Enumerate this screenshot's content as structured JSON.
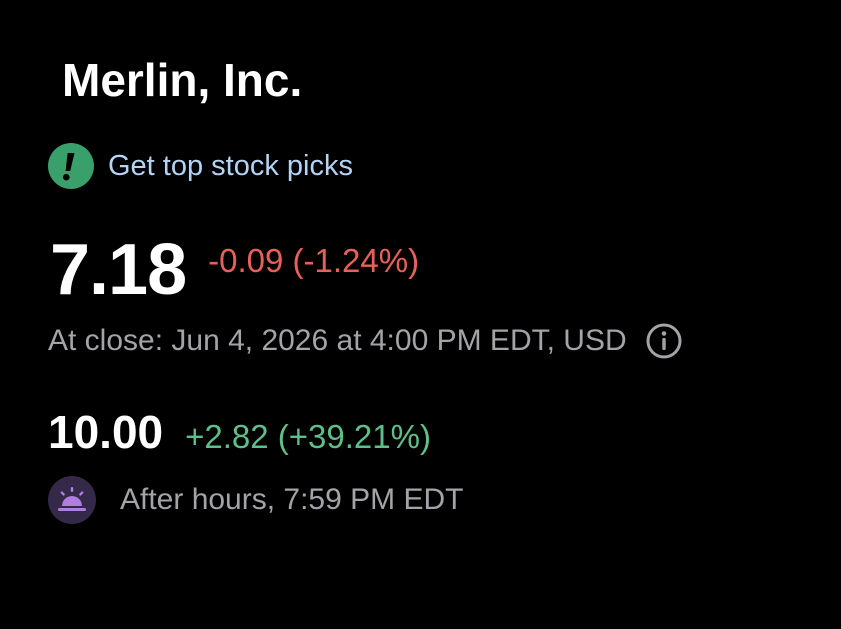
{
  "quote": {
    "company_name": "Merlin, Inc.",
    "promo": {
      "icon": "exclamation-badge-icon",
      "label": "Get top stock picks"
    },
    "regular": {
      "price": "7.18",
      "change": "-0.09 (-1.24%)",
      "close_info": "At close: Jun 4, 2026 at 4:00 PM EDT, USD",
      "info_icon": "info-icon"
    },
    "after_hours": {
      "price": "10.00",
      "change": "+2.82 (+39.21%)",
      "session_icon": "sunset-icon",
      "session_label": "After hours, 7:59 PM EDT"
    }
  },
  "colors": {
    "background": "#000000",
    "negative": "#e8605a",
    "positive": "#5fbf8a",
    "link": "#b3d4f5",
    "muted": "#a3a3a8",
    "promo_badge": "#3aa06b",
    "session_badge": "#35294a",
    "session_icon": "#b07de0"
  }
}
